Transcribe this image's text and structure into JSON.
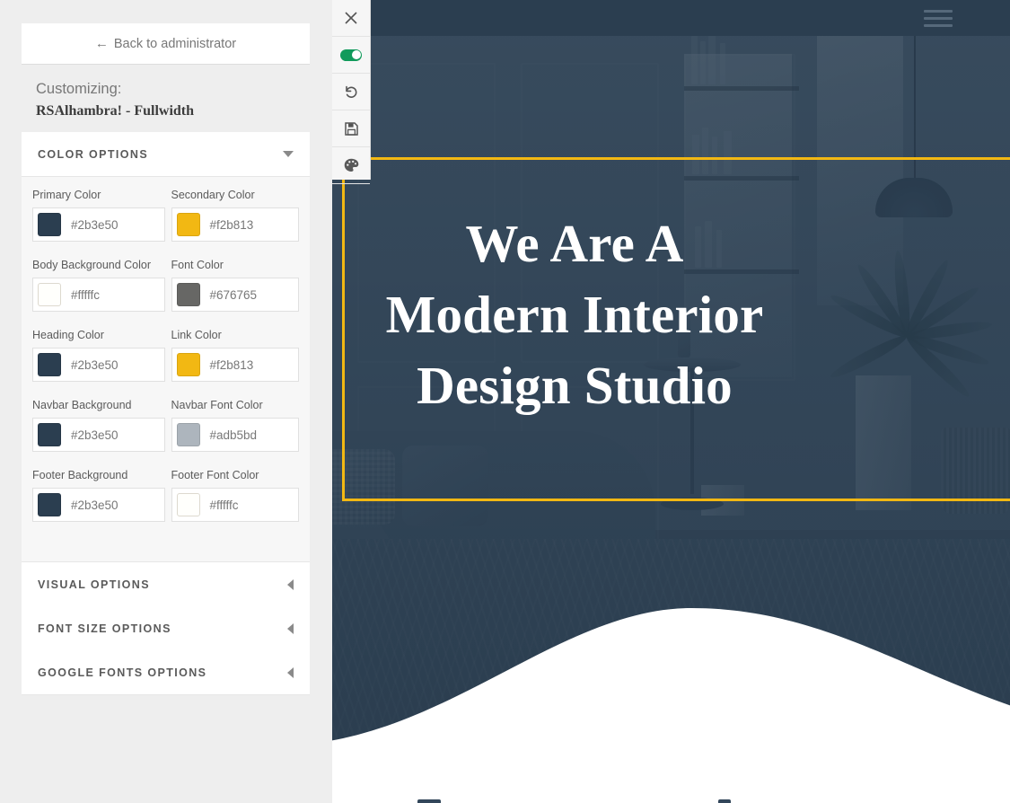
{
  "customizer": {
    "back_label": "Back to administrator",
    "back_arrow": "←",
    "customizing_label": "Customizing:",
    "theme_name": "RSAlhambra! - Fullwidth",
    "sections": [
      {
        "title": "COLOR OPTIONS",
        "state": "expanded",
        "chevron": "chevron-down-icon"
      },
      {
        "title": "VISUAL OPTIONS",
        "state": "collapsed",
        "chevron": "chevron-left-icon"
      },
      {
        "title": "FONT SIZE OPTIONS",
        "state": "collapsed",
        "chevron": "chevron-left-icon"
      },
      {
        "title": "GOOGLE FONTS OPTIONS",
        "state": "collapsed",
        "chevron": "chevron-left-icon"
      }
    ],
    "color_fields": [
      {
        "label": "Primary Color",
        "value": "#2b3e50"
      },
      {
        "label": "Secondary Color",
        "value": "#f2b813"
      },
      {
        "label": "Body Background Color",
        "value": "#fffffc"
      },
      {
        "label": "Font Color",
        "value": "#676765"
      },
      {
        "label": "Heading Color",
        "value": "#2b3e50"
      },
      {
        "label": "Link Color",
        "value": "#f2b813"
      },
      {
        "label": "Navbar Background",
        "value": "#2b3e50"
      },
      {
        "label": "Navbar Font Color",
        "value": "#adb5bd"
      },
      {
        "label": "Footer Background",
        "value": "#2b3e50"
      },
      {
        "label": "Footer Font Color",
        "value": "#fffffc"
      }
    ]
  },
  "toolbar": {
    "items": [
      {
        "name": "close-icon",
        "title": "Close"
      },
      {
        "name": "toggle-switch",
        "title": "Enable",
        "state": "on",
        "color": "#119a5b"
      },
      {
        "name": "undo-icon",
        "title": "Undo"
      },
      {
        "name": "save-icon",
        "title": "Save"
      },
      {
        "name": "palette-icon",
        "title": "Palette"
      }
    ]
  },
  "preview": {
    "navbar": {
      "background": "#2b3e50",
      "menu_icon": "hamburger-icon"
    },
    "hero": {
      "heading_lines": [
        "We Are A",
        "Modern Interior",
        "Design Studio"
      ],
      "frame_color": "#f2b813",
      "overlay_color": "#2b3e50"
    }
  }
}
